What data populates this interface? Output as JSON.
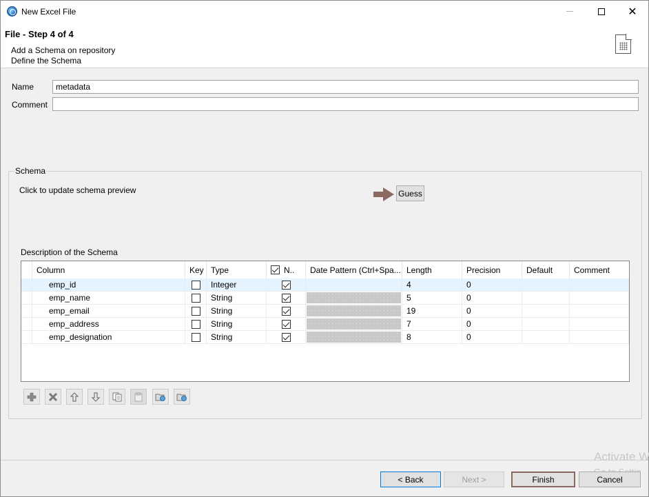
{
  "window": {
    "title": "New Excel File"
  },
  "header": {
    "step_title": "File - Step 4 of 4",
    "description_line1": "Add a Schema on repository",
    "description_line2": "Define the Schema"
  },
  "form": {
    "name_label": "Name",
    "name_value": "metadata",
    "comment_label": "Comment",
    "comment_value": ""
  },
  "schema": {
    "group_label": "Schema",
    "update_text": "Click to update schema preview",
    "guess_label": "Guess",
    "description_label": "Description of the Schema",
    "columns": [
      "Column",
      "Key",
      "Type",
      "N..",
      "Date Pattern (Ctrl+Spa...",
      "Length",
      "Precision",
      "Default",
      "Comment"
    ],
    "rows": [
      {
        "column": "emp_id",
        "key": false,
        "type": "Integer",
        "nullable": true,
        "date_pattern": "",
        "length": "4",
        "precision": "0",
        "default": "",
        "comment": ""
      },
      {
        "column": "emp_name",
        "key": false,
        "type": "String",
        "nullable": true,
        "date_pattern": "",
        "length": "5",
        "precision": "0",
        "default": "",
        "comment": ""
      },
      {
        "column": "emp_email",
        "key": false,
        "type": "String",
        "nullable": true,
        "date_pattern": "",
        "length": "19",
        "precision": "0",
        "default": "",
        "comment": ""
      },
      {
        "column": "emp_address",
        "key": false,
        "type": "String",
        "nullable": true,
        "date_pattern": "",
        "length": "7",
        "precision": "0",
        "default": "",
        "comment": ""
      },
      {
        "column": "emp_designation",
        "key": false,
        "type": "String",
        "nullable": true,
        "date_pattern": "",
        "length": "8",
        "precision": "0",
        "default": "",
        "comment": ""
      }
    ],
    "toolbar_icons": [
      "add-icon",
      "remove-icon",
      "move-up-icon",
      "move-down-icon",
      "copy-icon",
      "paste-icon",
      "import-icon",
      "export-icon"
    ]
  },
  "buttons": {
    "back": "< Back",
    "next": "Next >",
    "finish": "Finish",
    "cancel": "Cancel"
  },
  "watermark": {
    "line1": "Activate W",
    "line2": "Go to Settin"
  }
}
